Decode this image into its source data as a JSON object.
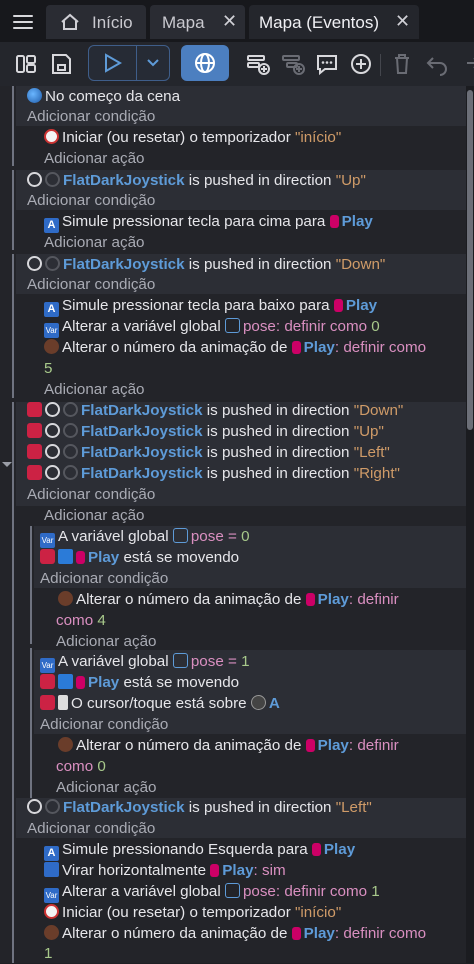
{
  "tabs": [
    {
      "label": "Início"
    },
    {
      "label": "Mapa",
      "close": "✕"
    },
    {
      "label": "Mapa (Eventos)",
      "close": "✕"
    }
  ],
  "toolbar": {
    "icons": [
      "events-panel-icon",
      "save-icon",
      "play-icon",
      "chevron-down-icon",
      "globe-icon",
      "add-event-icon",
      "add-subevent-icon",
      "comment-icon",
      "add-icon",
      "delete-icon",
      "undo-icon",
      "redo-icon"
    ]
  },
  "rows": {
    "r1": "No começo da cena",
    "r2": "Adicionar condição",
    "r3a": "Iniciar (ou resetar) o temporizador ",
    "r3b": "\"início\"",
    "r4": "Adicionar ação",
    "e2obj": "FlatDarkJoystick",
    "e2txt": " is pushed in direction ",
    "e2dir": "\"Up\"",
    "e2add": "Adicionar condição",
    "e2act": "Simule pressionar tecla para cima para ",
    "play": "Play",
    "e2addact": "Adicionar ação",
    "e3dir": "\"Down\"",
    "e3act1": "Simule pressionar tecla para baixo para ",
    "e3act2a": "Alterar a variável global ",
    "e3act2var": "pose",
    "e3act2b": ": definir como ",
    "e3act2num": "0",
    "e3act3a": "Alterar o número da animação de ",
    "e3act3b": ": definir como",
    "e3act3num": "5",
    "e4dir1": "\"Down\"",
    "e4dir2": "\"Up\"",
    "e4dir3": "\"Left\"",
    "e4dir4": "\"Right\"",
    "s1a": "A variável global ",
    "s1eq": " = ",
    "s1num": "0",
    "s1b": " está se movendo",
    "s1act": "Alterar o número da animação de ",
    "s1defin": ": definir",
    "s1como": "como ",
    "s1n": "4",
    "s2num": "1",
    "s2cursor": "O cursor/toque está sobre ",
    "s2A": "A",
    "s2n": "0",
    "e5dir": "\"Left\"",
    "e5act1": "Simule pressionando Esquerda para ",
    "e5act2": "Virar horizontalmente ",
    "e5act2b": ": sim",
    "e5act3b": ": definir como ",
    "e5act3num": "1",
    "e5act4a": "Iniciar (ou resetar) o temporizador ",
    "e5act4b": "\"início\"",
    "e5act5num": "1"
  }
}
